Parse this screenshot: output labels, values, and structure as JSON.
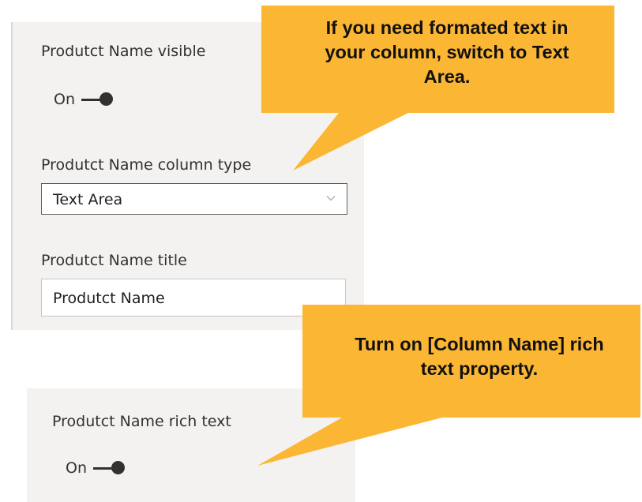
{
  "panel_top": {
    "visible_label": "Produtct Name visible",
    "visible_toggle_state": "On",
    "column_type_label": "Produtct Name column type",
    "column_type_value": "Text Area",
    "title_label": "Produtct Name title",
    "title_value": "Produtct Name"
  },
  "panel_bottom": {
    "rich_text_label": "Produtct Name rich text",
    "rich_text_toggle_state": "On"
  },
  "callouts": {
    "top": {
      "line1": "If you need formated text in",
      "line2": "your column, switch to Text",
      "line3": "Area."
    },
    "bottom": {
      "line1": "Turn on [Column Name] rich",
      "line2": "text property."
    }
  },
  "colors": {
    "panel_background": "#f3f2f1",
    "callout_fill": "#fbb634",
    "text": "#323130",
    "toggle": "#323130"
  },
  "icons": {
    "dropdown": "chevron-down-icon"
  }
}
